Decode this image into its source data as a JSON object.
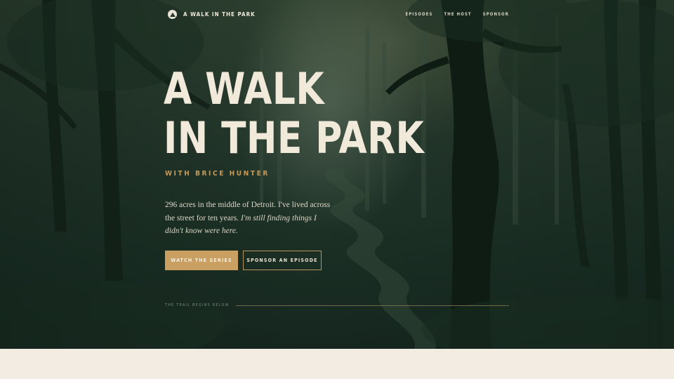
{
  "colors": {
    "hero_bg": "#24372b",
    "accent_gold": "#c9a062",
    "title_cream": "#f1e9da",
    "page_bg": "#f3ece2"
  },
  "nav": {
    "logo_icon": "hiker-logo-icon",
    "brand": "A WALK IN THE PARK",
    "links": [
      "EPISODES",
      "THE HOST",
      "SPONSOR"
    ]
  },
  "hero": {
    "title_line1": "A WALK",
    "title_line2": "IN THE PARK",
    "subtitle": "WITH BRICE HUNTER",
    "intro_plain": "296 acres in the middle of Detroit. I've lived across the street for ten years.",
    "intro_italic": "I'm still finding things I didn't know were here.",
    "primary_button": "WATCH THE SERIES",
    "secondary_button": "SPONSOR AN EPISODE",
    "trail_label": "THE TRAIL BEGINS BELOW"
  }
}
